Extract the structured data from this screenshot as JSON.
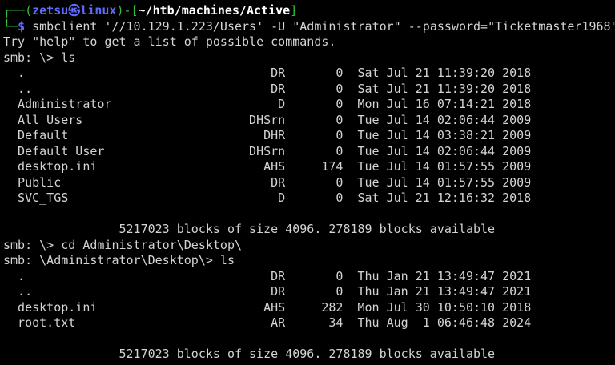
{
  "prompt": {
    "user": "zetsu",
    "at_symbol": "㉿",
    "host": "linux",
    "path": "~/htb/machines/Active",
    "symbol": "$",
    "command": "smbclient '//10.129.1.223/Users' -U \"Administrator\" --password=\"Ticketmaster1968\""
  },
  "help_text": "Try \"help\" to get a list of possible commands.",
  "session1": {
    "prompt_cmd": "smb: \\> ls",
    "entries": [
      {
        "name": ".",
        "attr": "DR",
        "size": "0",
        "date": "Sat Jul 21 11:39:20 2018"
      },
      {
        "name": "..",
        "attr": "DR",
        "size": "0",
        "date": "Sat Jul 21 11:39:20 2018"
      },
      {
        "name": "Administrator",
        "attr": "D",
        "size": "0",
        "date": "Mon Jul 16 07:14:21 2018"
      },
      {
        "name": "All Users",
        "attr": "DHSrn",
        "size": "0",
        "date": "Tue Jul 14 02:06:44 2009"
      },
      {
        "name": "Default",
        "attr": "DHR",
        "size": "0",
        "date": "Tue Jul 14 03:38:21 2009"
      },
      {
        "name": "Default User",
        "attr": "DHSrn",
        "size": "0",
        "date": "Tue Jul 14 02:06:44 2009"
      },
      {
        "name": "desktop.ini",
        "attr": "AHS",
        "size": "174",
        "date": "Tue Jul 14 01:57:55 2009"
      },
      {
        "name": "Public",
        "attr": "DR",
        "size": "0",
        "date": "Tue Jul 14 01:57:55 2009"
      },
      {
        "name": "SVC_TGS",
        "attr": "D",
        "size": "0",
        "date": "Sat Jul 21 12:16:32 2018"
      }
    ],
    "summary": "5217023 blocks of size 4096. 278189 blocks available"
  },
  "cd_cmd": "smb: \\> cd Administrator\\Desktop\\",
  "session2": {
    "prompt_cmd": "smb: \\Administrator\\Desktop\\> ls",
    "entries": [
      {
        "name": ".",
        "attr": "DR",
        "size": "0",
        "date": "Thu Jan 21 13:49:47 2021"
      },
      {
        "name": "..",
        "attr": "DR",
        "size": "0",
        "date": "Thu Jan 21 13:49:47 2021"
      },
      {
        "name": "desktop.ini",
        "attr": "AHS",
        "size": "282",
        "date": "Mon Jul 30 10:50:10 2018"
      },
      {
        "name": "root.txt",
        "attr": "AR",
        "size": "34",
        "date": "Thu Aug  1 06:46:48 2024"
      }
    ],
    "summary": "5217023 blocks of size 4096. 278189 blocks available"
  },
  "colors": {
    "prompt_frame": "#2fbf3a",
    "user_host": "#5f6bff",
    "path": "#ffffff",
    "text": "#d4d4d4",
    "background": "#000000"
  }
}
